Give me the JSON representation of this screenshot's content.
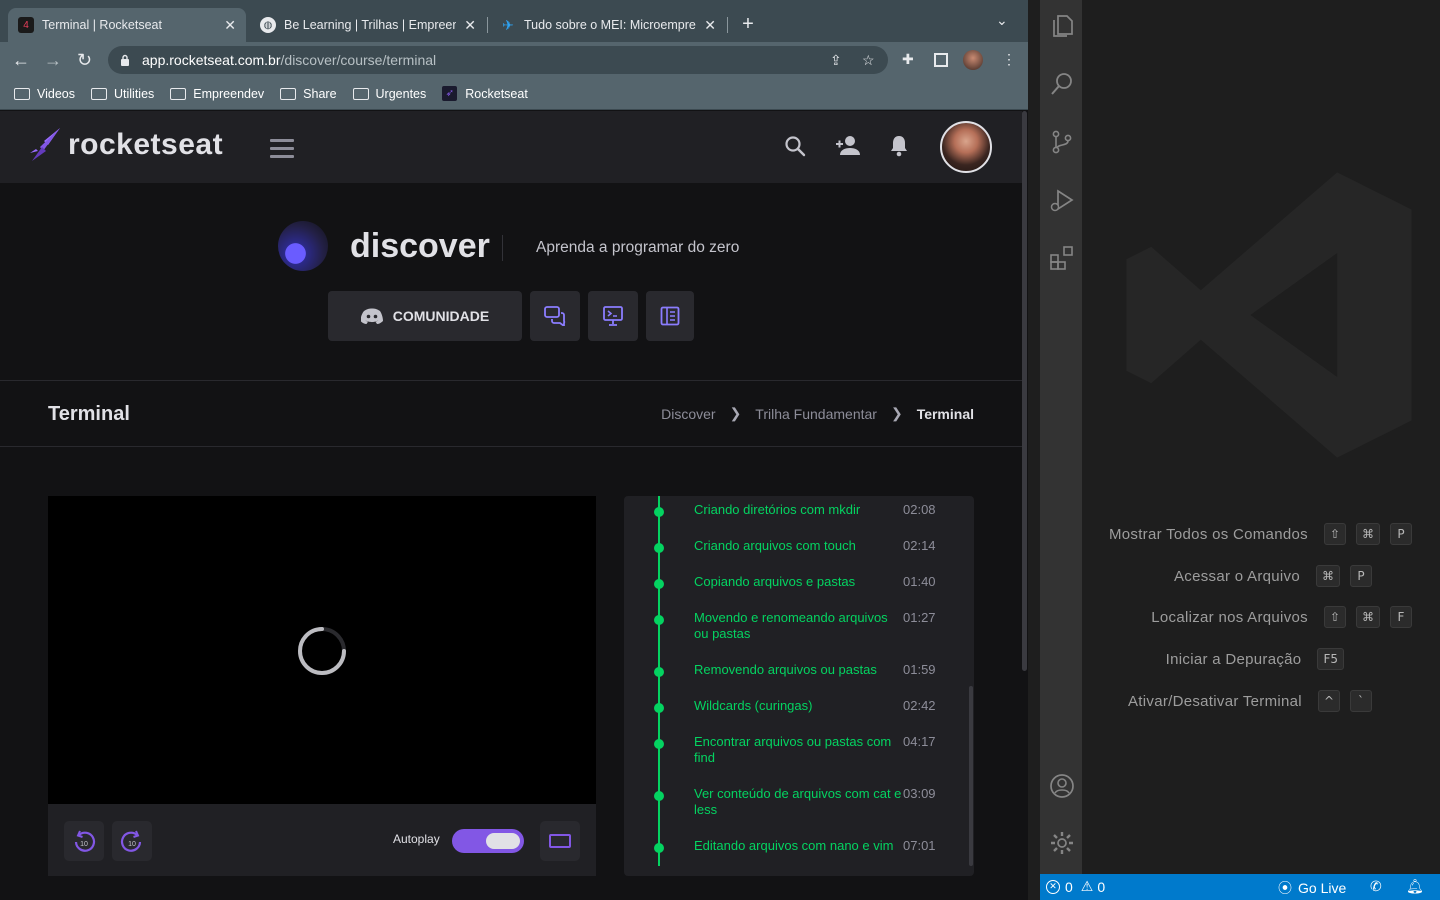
{
  "browser": {
    "tabs": [
      {
        "title": "Terminal | Rocketseat",
        "active": true
      },
      {
        "title": "Be Learning | Trilhas | Empreendedorismo",
        "active": false
      },
      {
        "title": "Tudo sobre o MEI: Microempreendedor",
        "active": false
      }
    ],
    "url_host": "app.rocketseat.com.br",
    "url_path": "/discover/course/terminal",
    "bookmarks": [
      "Videos",
      "Utilities",
      "Empreendev",
      "Share",
      "Urgentes",
      "Rocketseat"
    ]
  },
  "site": {
    "logo_text": "rocketseat",
    "hero_title": "discover",
    "hero_subtitle": "Aprenda a programar do zero",
    "community_label": "COMUNIDADE",
    "page_title": "Terminal",
    "breadcrumb": [
      "Discover",
      "Trilha Fundamentar",
      "Terminal"
    ],
    "autoplay_label": "Autoplay",
    "autoplay_on": true,
    "lessons": [
      {
        "title": "Criando diretórios com mkdir",
        "duration": "02:08"
      },
      {
        "title": "Criando arquivos com touch",
        "duration": "02:14"
      },
      {
        "title": "Copiando arquivos e pastas",
        "duration": "01:40"
      },
      {
        "title": "Movendo e renomeando arquivos ou pastas",
        "duration": "01:27"
      },
      {
        "title": "Removendo arquivos ou pastas",
        "duration": "01:59"
      },
      {
        "title": "Wildcards (curingas)",
        "duration": "02:42"
      },
      {
        "title": "Encontrar arquivos ou pastas com find",
        "duration": "04:17"
      },
      {
        "title": "Ver conteúdo de arquivos com cat e less",
        "duration": "03:09"
      },
      {
        "title": "Editando arquivos com nano e vim",
        "duration": "07:01"
      }
    ],
    "accent": "#8257e5",
    "lesson_color": "#04d361"
  },
  "vscode": {
    "commands": [
      {
        "label": "Mostrar Todos os Comandos",
        "keys": [
          "⇧",
          "⌘",
          "P"
        ]
      },
      {
        "label": "Acessar o Arquivo",
        "keys": [
          "⌘",
          "P"
        ]
      },
      {
        "label": "Localizar nos Arquivos",
        "keys": [
          "⇧",
          "⌘",
          "F"
        ]
      },
      {
        "label": "Iniciar a Depuração",
        "keys": [
          "F5"
        ]
      },
      {
        "label": "Ativar/Desativar Terminal",
        "keys": [
          "^",
          "`"
        ]
      }
    ],
    "status": {
      "errors": "0",
      "warnings": "0",
      "go_live": "Go Live"
    },
    "status_color": "#007acc"
  }
}
